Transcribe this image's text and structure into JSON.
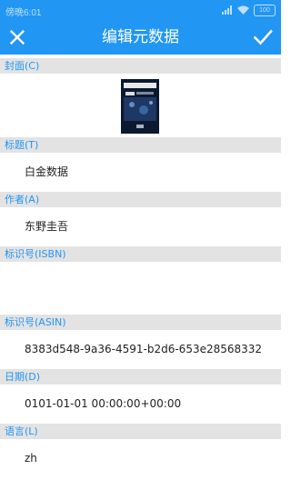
{
  "status_bar": {
    "time": "傍晚6:01",
    "battery": "100"
  },
  "app_bar": {
    "title": "编辑元数据",
    "close_icon": "close-icon",
    "save_icon": "check-icon"
  },
  "sections": {
    "cover": {
      "label": "封面(C)"
    },
    "title": {
      "label": "标题(T)",
      "value": "白金数据"
    },
    "author": {
      "label": "作者(A)",
      "value": "东野圭吾"
    },
    "isbn": {
      "label": "标识号(ISBN)",
      "value": ""
    },
    "asin": {
      "label": "标识号(ASIN)",
      "value": "8383d548-9a36-4591-b2d6-653e28568332"
    },
    "date": {
      "label": "日期(D)",
      "value": "0101-01-01 00:00:00+00:00"
    },
    "language": {
      "label": "语言(L)",
      "value": "zh"
    }
  },
  "colors": {
    "accent": "#2196f3",
    "header_bg": "#e3e3e3"
  }
}
